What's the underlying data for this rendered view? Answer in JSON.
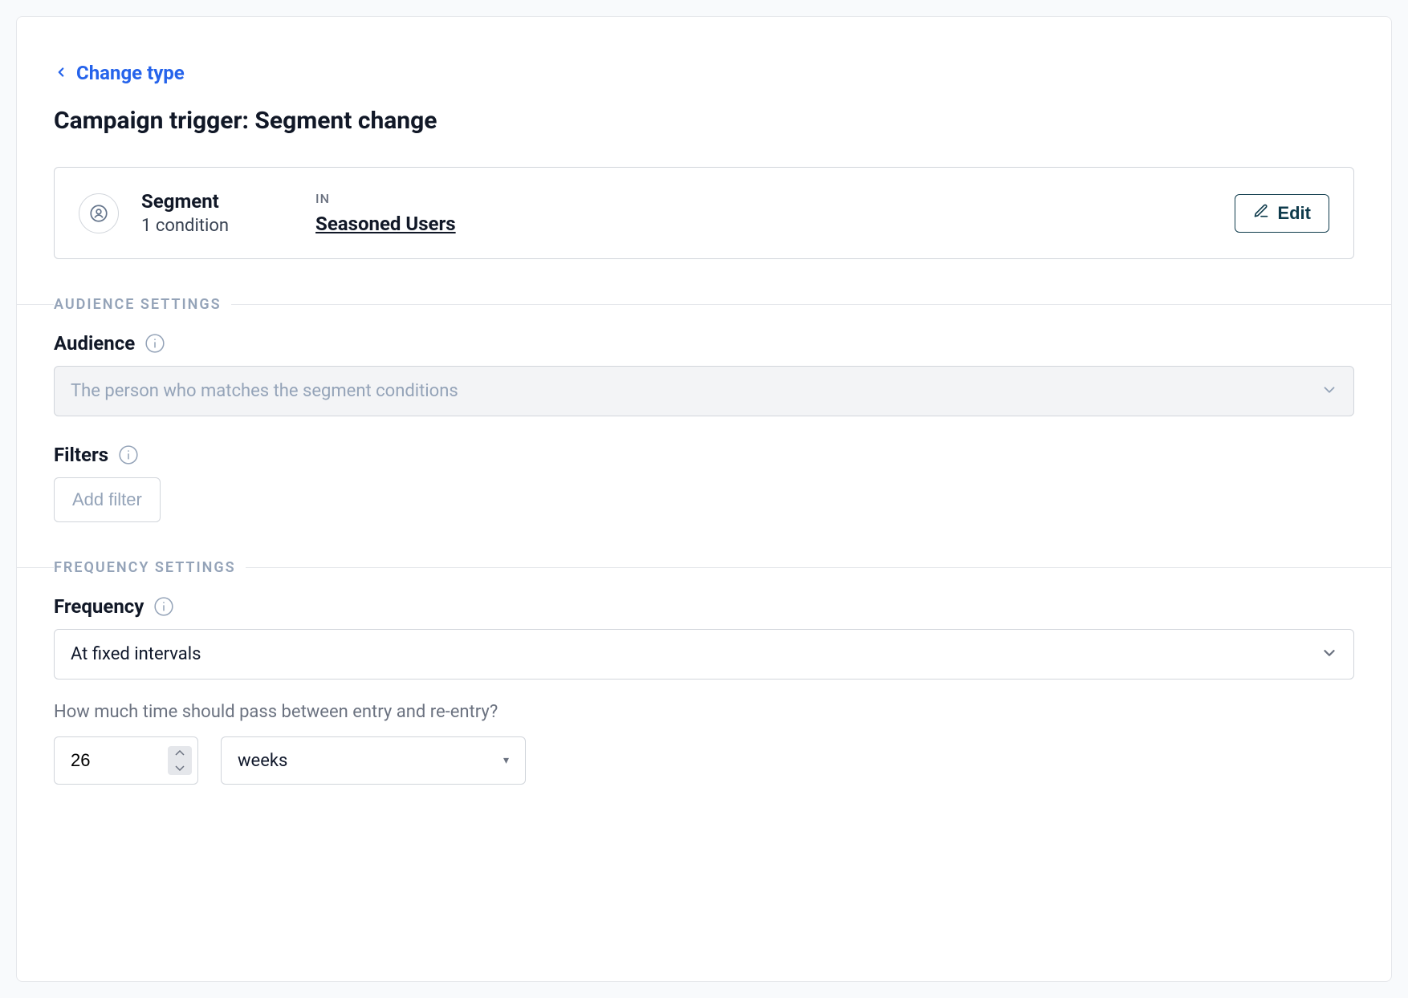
{
  "header": {
    "back_label": "Change type",
    "page_title": "Campaign trigger: Segment change"
  },
  "trigger_card": {
    "title": "Segment",
    "subtitle": "1 condition",
    "relation_label": "IN",
    "segment_name": "Seasoned Users",
    "edit_label": "Edit"
  },
  "sections": {
    "audience_label": "AUDIENCE SETTINGS",
    "frequency_label": "FREQUENCY SETTINGS"
  },
  "audience": {
    "field_label": "Audience",
    "select_value": "The person who matches the segment conditions"
  },
  "filters": {
    "field_label": "Filters",
    "add_button_label": "Add filter"
  },
  "frequency": {
    "field_label": "Frequency",
    "select_value": "At fixed intervals",
    "helper_text": "How much time should pass between entry and re-entry?",
    "interval_value": "26",
    "interval_unit": "weeks"
  }
}
